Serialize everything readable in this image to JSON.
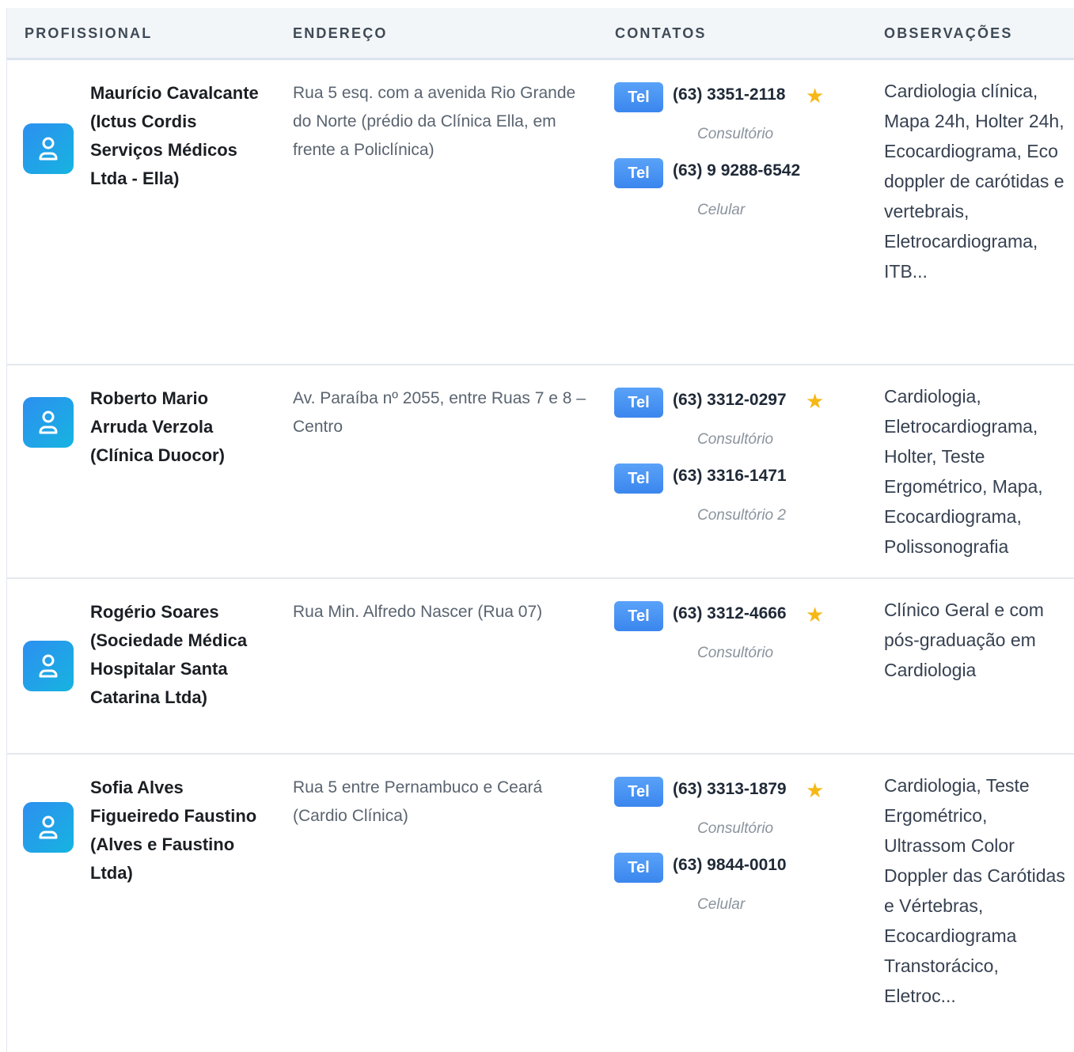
{
  "headers": {
    "professional": "PROFISSIONAL",
    "address": "ENDEREÇO",
    "contacts": "CONTATOS",
    "notes": "OBSERVAÇÕES"
  },
  "colors": {
    "accent": "#3a86ee",
    "avatar_gradient_start": "#2d8ff0",
    "avatar_gradient_end": "#16b4e0",
    "star": "#f5b816"
  },
  "rows": [
    {
      "name": "Maurício Cavalcante (Ictus Cordis Serviços Médicos Ltda - Ella)",
      "address": "Rua 5 esq. com a avenida Rio Grande do Norte (prédio da Clínica Ella, em frente a Policlínica)",
      "contacts": [
        {
          "badge": "Tel",
          "phone": "(63) 3351-2118",
          "starred": true,
          "star": "★",
          "type": "Consultório"
        },
        {
          "badge": "Tel",
          "phone": "(63) 9 9288-6542",
          "starred": false,
          "star": "",
          "type": "Celular"
        }
      ],
      "notes": "Cardiologia clínica, Mapa 24h, Holter 24h, Ecocardiograma, Eco doppler de carótidas e vertebrais, Eletrocardiograma, ITB..."
    },
    {
      "name": "Roberto Mario Arruda Verzola (Clínica Duocor)",
      "address": "Av. Paraíba nº 2055, entre Ruas 7 e 8 – Centro",
      "contacts": [
        {
          "badge": "Tel",
          "phone": "(63) 3312-0297",
          "starred": true,
          "star": "★",
          "type": "Consultório"
        },
        {
          "badge": "Tel",
          "phone": "(63) 3316-1471",
          "starred": false,
          "star": "",
          "type": "Consultório 2"
        }
      ],
      "notes": "Cardiologia, Eletrocardiograma, Holter, Teste Ergométrico, Mapa, Ecocardiograma, Polissonografia"
    },
    {
      "name": "Rogério Soares (Sociedade Médica Hospitalar Santa Catarina Ltda)",
      "address": "Rua Min. Alfredo Nascer (Rua 07)",
      "contacts": [
        {
          "badge": "Tel",
          "phone": "(63) 3312-4666",
          "starred": true,
          "star": "★",
          "type": "Consultório"
        }
      ],
      "notes": "Clínico Geral e com pós-graduação em Cardiologia"
    },
    {
      "name": "Sofia Alves Figueiredo Faustino (Alves e Faustino Ltda)",
      "address": "Rua 5 entre Pernambuco e Ceará (Cardio Clínica)",
      "contacts": [
        {
          "badge": "Tel",
          "phone": "(63) 3313-1879",
          "starred": true,
          "star": "★",
          "type": "Consultório"
        },
        {
          "badge": "Tel",
          "phone": "(63) 9844-0010",
          "starred": false,
          "star": "",
          "type": "Celular"
        }
      ],
      "notes": "Cardiologia, Teste Ergométrico, Ultrassom Color Doppler das Carótidas e Vértebras, Ecocardiograma Transtorácico, Eletroc..."
    }
  ]
}
